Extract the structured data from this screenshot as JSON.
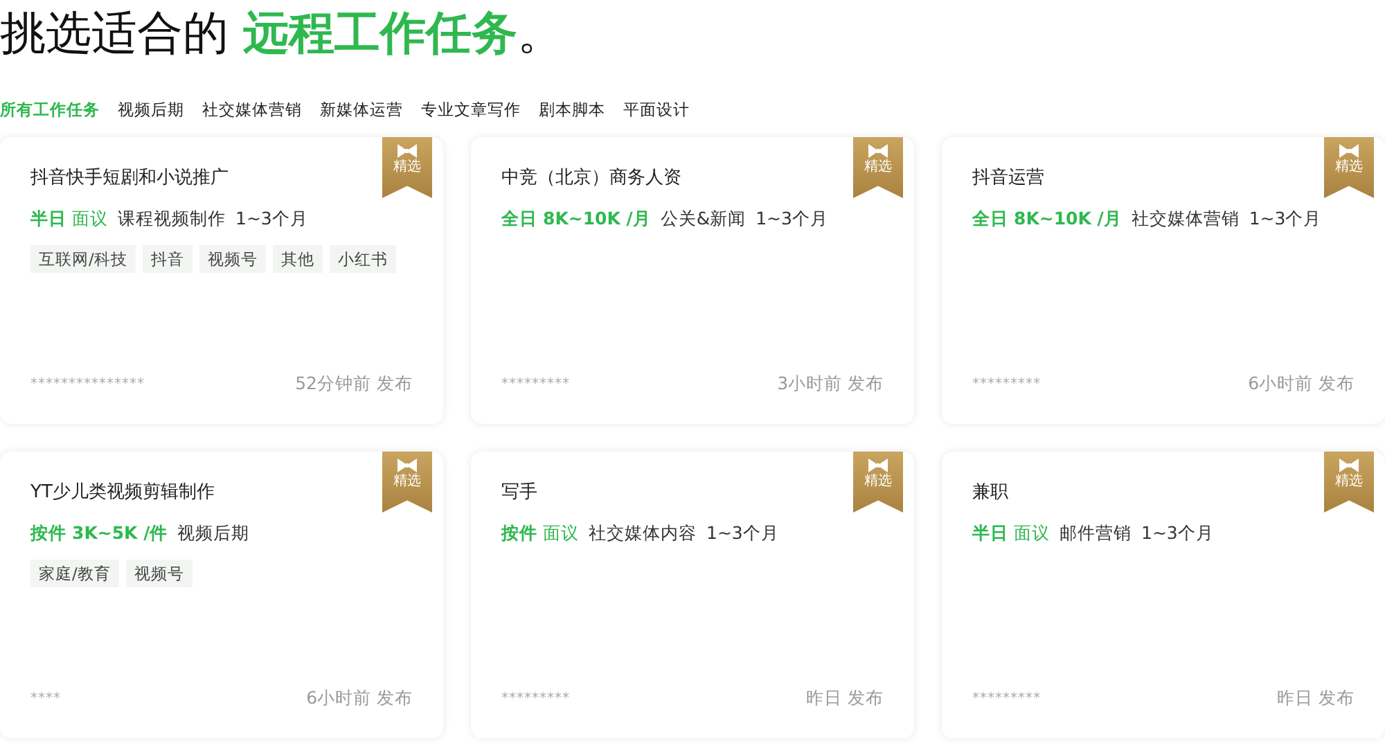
{
  "heading": "挑选适合的 **远程工作任务**。",
  "tabs": [
    {
      "label": "所有工作任务",
      "selected": true
    },
    {
      "label": "视频后期",
      "selected": false
    },
    {
      "label": "社交媒体营销",
      "selected": false
    },
    {
      "label": "新媒体运营",
      "selected": false
    },
    {
      "label": "专业文章写作",
      "selected": false
    },
    {
      "label": "剧本脚本",
      "selected": false
    },
    {
      "label": "平面设计",
      "selected": false
    }
  ],
  "cards": [
    {
      "title": "抖音快手短剧和小说推广",
      "featured": true,
      "badge": "精选",
      "schedule": "半日",
      "pay": "面议",
      "pay_bold": false,
      "category": "课程视频制作",
      "duration": "1~3个月",
      "tags": [
        "互联网/科技",
        "抖音",
        "视频号",
        "其他",
        "小红书"
      ],
      "poster": "***************",
      "posted": "52分钟前 发布"
    },
    {
      "title": "中竞（北京）商务人资",
      "featured": true,
      "badge": "精选",
      "schedule": "全日",
      "pay": "8K~10K /月",
      "pay_bold": true,
      "category": "公关&新闻",
      "duration": "1~3个月",
      "poster": "*********",
      "posted": "3小时前 发布"
    },
    {
      "title": "抖音运营",
      "featured": true,
      "badge": "精选",
      "schedule": "全日",
      "pay": "8K~10K /月",
      "pay_bold": true,
      "category": "社交媒体营销",
      "duration": "1~3个月",
      "poster": "*********",
      "posted": "6小时前 发布"
    },
    {
      "title": "YT少儿类视频剪辑制作",
      "featured": true,
      "badge": "精选",
      "schedule": "按件",
      "pay": "3K~5K /件",
      "pay_bold": true,
      "category": "视频后期",
      "tags": [
        "家庭/教育",
        "视频号"
      ],
      "poster": "****",
      "posted": "6小时前 发布"
    },
    {
      "title": "写手",
      "featured": true,
      "badge": "精选",
      "schedule": "按件",
      "pay": "面议",
      "pay_bold": false,
      "category": "社交媒体内容",
      "duration": "1~3个月",
      "poster": "*********",
      "posted": "昨日 发布"
    },
    {
      "title": "兼职",
      "featured": true,
      "badge": "精选",
      "schedule": "半日",
      "pay": "面议",
      "pay_bold": false,
      "category": "邮件营销",
      "duration": "1~3个月",
      "poster": "*********",
      "posted": "昨日 发布"
    }
  ]
}
